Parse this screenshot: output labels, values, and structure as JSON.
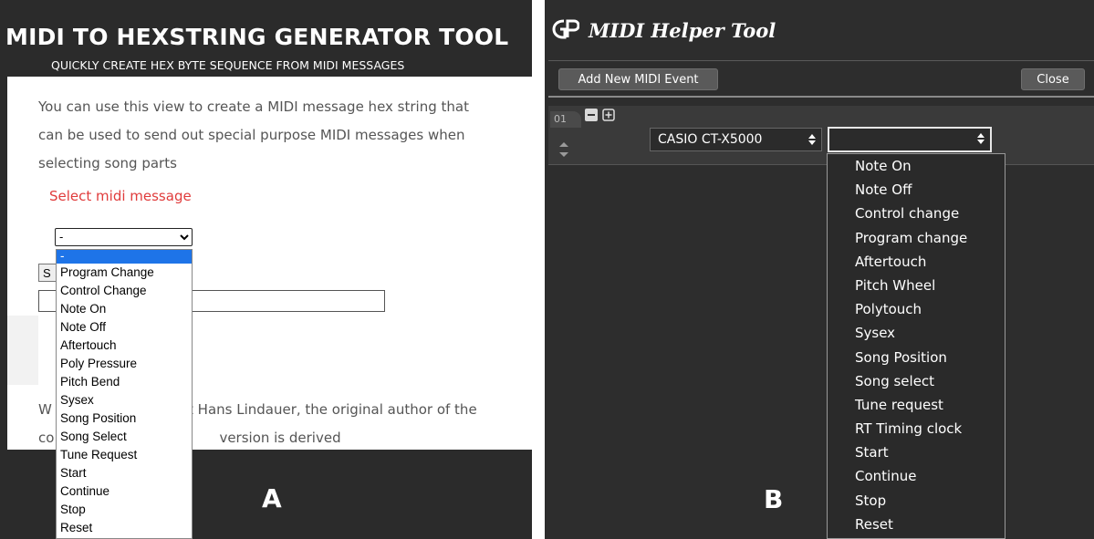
{
  "panel_a": {
    "title": "MIDI TO HEXSTRING GENERATOR TOOL",
    "subtitle": "QUICKLY CREATE HEX BYTE SEQUENCE FROM MIDI MESSAGES",
    "description_lines": [
      "You can use this view to create a MIDI message hex string that",
      "can be used to send out special purpose MIDI messages when",
      "selecting song parts"
    ],
    "select_label": "Select midi message",
    "select_value": "-",
    "partial_button_label": "S",
    "credit_visible_start": "W",
    "credit_visible_middle": "it Hans Lindauer, the original author of the",
    "credit_visible_line2_start": "co",
    "credit_visible_line2_end": "version is derived",
    "panel_letter": "A",
    "dropdown_options": [
      "-",
      "Program Change",
      "Control Change",
      "Note On",
      "Note Off",
      "Aftertouch",
      "Poly Pressure",
      "Pitch Bend",
      "Sysex",
      "Song Position",
      "Song Select",
      "Tune Request",
      "Start",
      "Continue",
      "Stop",
      "Reset"
    ],
    "dropdown_selected_index": 0,
    "colors": {
      "header_bg": "#2b2b2b",
      "label_red": "#e03b3b",
      "selected_blue": "#1e74e8"
    }
  },
  "panel_b": {
    "title": "MIDI Helper Tool",
    "add_button": "Add New MIDI Event",
    "close_button": "Close",
    "row_number": "01",
    "device_value": "CASIO CT-X5000",
    "message_value": "",
    "panel_letter": "B",
    "dropdown_options": [
      "Note On",
      "Note Off",
      "Control change",
      "Program change",
      "Aftertouch",
      "Pitch Wheel",
      "Polytouch",
      "Sysex",
      "Song Position",
      "Song select",
      "Tune request",
      "RT Timing clock",
      "Start",
      "Continue",
      "Stop",
      "Reset"
    ],
    "colors": {
      "bg": "#2d2d2d",
      "dropdown_bg": "#2a2a2a"
    }
  },
  "icons": [
    "gp-logo-icon",
    "chevron-down-icon",
    "minus-icon",
    "plus-box-icon",
    "up-down-arrows-icon",
    "select-arrows-icon"
  ]
}
